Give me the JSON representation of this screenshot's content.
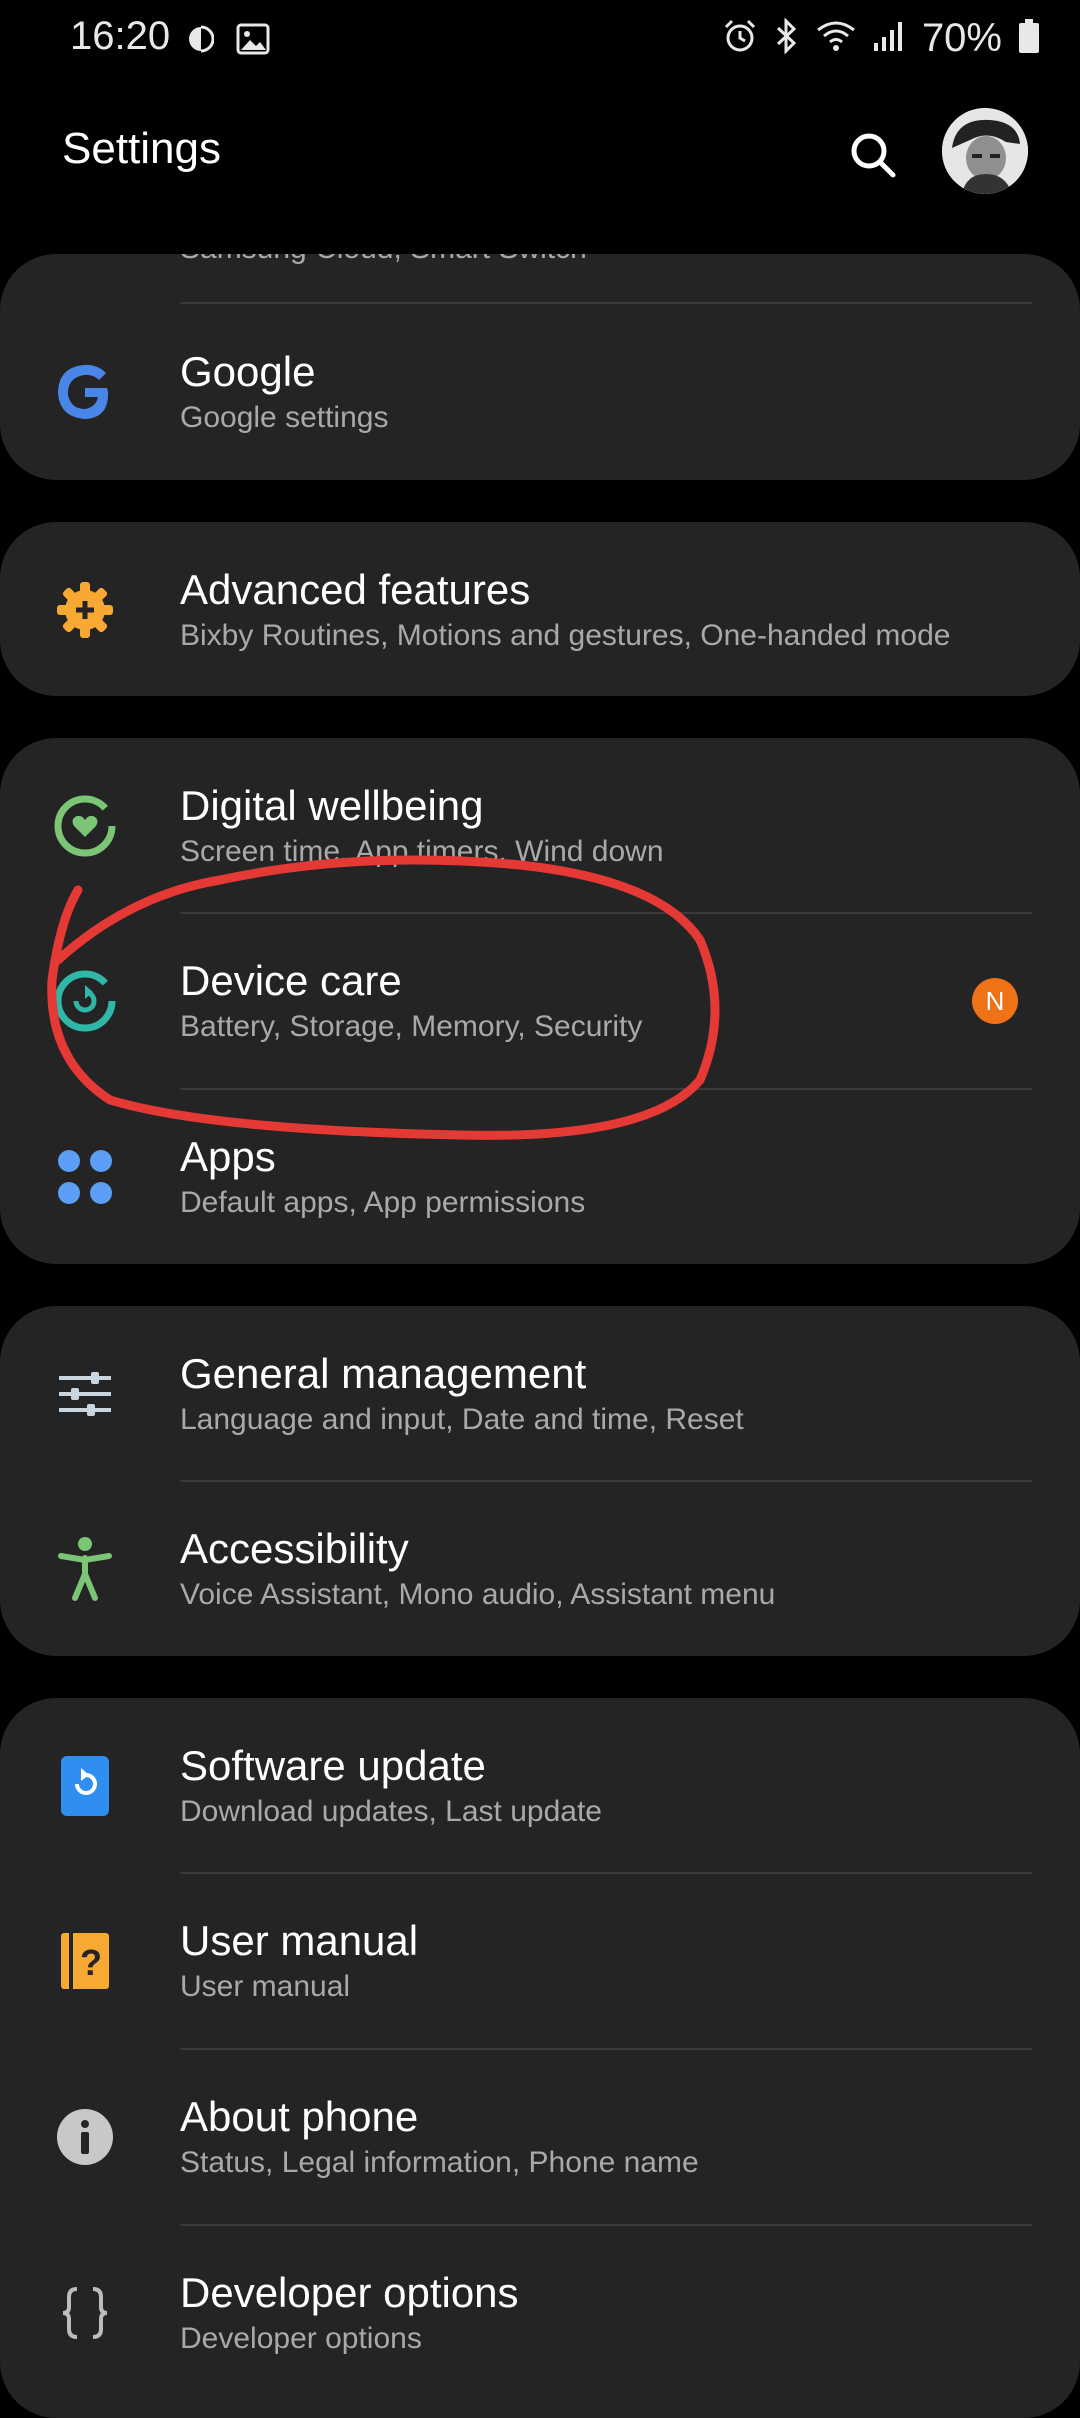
{
  "status_bar": {
    "time": "16:20",
    "battery": "70%",
    "left_icons": [
      "contrast-icon",
      "image-icon"
    ],
    "right_icons": [
      "alarm-icon",
      "bluetooth-icon",
      "wifi-icon",
      "signal-icon",
      "battery-icon"
    ]
  },
  "header": {
    "title": "Settings"
  },
  "cards": [
    {
      "partial": "Samsung Cloud, Smart Switch",
      "items": [
        {
          "title": "Google",
          "subtitle": "Google settings",
          "icon": "google-icon"
        }
      ]
    },
    {
      "items": [
        {
          "title": "Advanced features",
          "subtitle": "Bixby Routines, Motions and gestures, One-handed mode",
          "icon": "advanced-features-icon"
        }
      ]
    },
    {
      "items": [
        {
          "title": "Digital wellbeing",
          "subtitle": "Screen time, App timers, Wind down",
          "icon": "digital-wellbeing-icon"
        },
        {
          "title": "Device care",
          "subtitle": "Battery, Storage, Memory, Security",
          "icon": "device-care-icon",
          "badge": "N"
        },
        {
          "title": "Apps",
          "subtitle": "Default apps, App permissions",
          "icon": "apps-icon"
        }
      ]
    },
    {
      "items": [
        {
          "title": "General management",
          "subtitle": "Language and input, Date and time, Reset",
          "icon": "general-management-icon"
        },
        {
          "title": "Accessibility",
          "subtitle": "Voice Assistant, Mono audio, Assistant menu",
          "icon": "accessibility-icon"
        }
      ]
    },
    {
      "items": [
        {
          "title": "Software update",
          "subtitle": "Download updates, Last update",
          "icon": "software-update-icon"
        },
        {
          "title": "User manual",
          "subtitle": "User manual",
          "icon": "user-manual-icon"
        },
        {
          "title": "About phone",
          "subtitle": "Status, Legal information, Phone name",
          "icon": "about-phone-icon"
        },
        {
          "title": "Developer options",
          "subtitle": "Developer options",
          "icon": "developer-options-icon"
        }
      ]
    }
  ],
  "colors": {
    "background": "#000000",
    "card": "#242424",
    "subtitle": "#a9a9a9",
    "badge": "#f07216",
    "annotation": "#e53935"
  }
}
